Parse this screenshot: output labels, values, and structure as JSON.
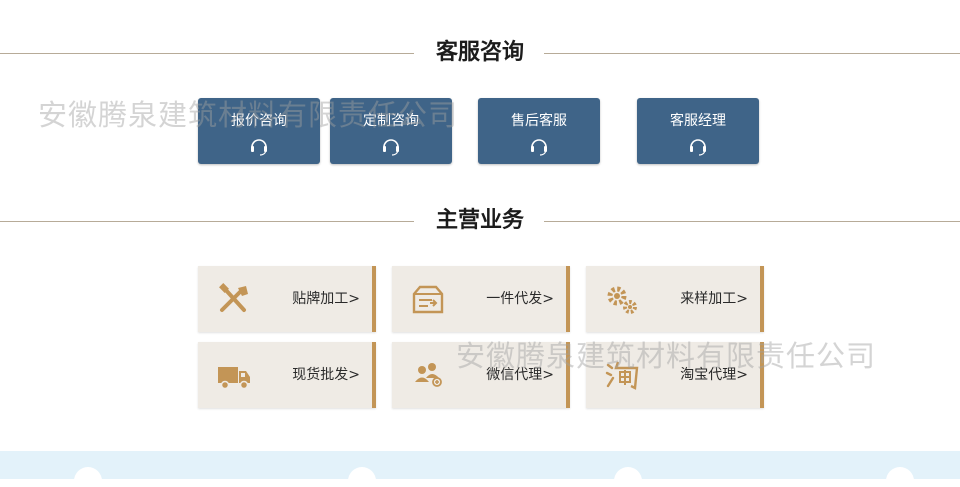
{
  "colors": {
    "consult_blue": "#3f6488",
    "gold": "#c39556",
    "card_bg": "#efebe5"
  },
  "consult": {
    "title": "客服咨询",
    "buttons": [
      {
        "label": "报价咨询",
        "icon": "headset-icon"
      },
      {
        "label": "定制咨询",
        "icon": "headset-icon"
      },
      {
        "label": "售后客服",
        "icon": "headset-icon"
      },
      {
        "label": "客服经理",
        "icon": "headset-icon"
      }
    ]
  },
  "business": {
    "title": "主营业务",
    "items": [
      {
        "label": "贴牌加工>",
        "icon": "tools-icon"
      },
      {
        "label": "一件代发>",
        "icon": "box-icon"
      },
      {
        "label": "来样加工>",
        "icon": "gears-icon"
      },
      {
        "label": "现货批发>",
        "icon": "truck-icon"
      },
      {
        "label": "微信代理>",
        "icon": "people-icon"
      },
      {
        "label": "淘宝代理>",
        "icon": "taobao-icon"
      }
    ]
  },
  "watermark": "安徽腾泉建筑材料有限责任公司"
}
